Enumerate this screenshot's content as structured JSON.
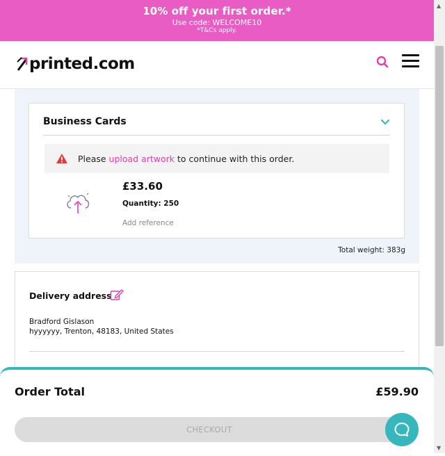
{
  "promo": {
    "headline": "10% off your first order.*",
    "code": "Use code: WELCOME10",
    "terms": "*T&Cs apply."
  },
  "header": {
    "logo_text": "printed.com",
    "search_icon": "search-icon",
    "menu_icon": "hamburger-menu-icon"
  },
  "cart": {
    "product": {
      "title": "Business Cards",
      "alert": {
        "prefix": "Please ",
        "link": "upload artwork",
        "suffix": " to continue with this order."
      },
      "price": "£33.60",
      "quantity": "Quantity: 250",
      "add_reference": "Add reference"
    },
    "total_weight": "Total weight: 383g"
  },
  "delivery": {
    "title": "Delivery address",
    "name": "Bradford Gislason",
    "address": "hyyyyyy, Trenton, 48183, United States"
  },
  "footer": {
    "order_total_label": "Order Total",
    "order_total_value": "£59.90",
    "checkout_label": "CHECKOUT"
  },
  "colors": {
    "promo_bg": "#e85cc4",
    "accent_pink": "#e240ab",
    "teal": "#36b6bd",
    "panel_bg": "#eef4fa",
    "warning_red": "#e53935"
  }
}
